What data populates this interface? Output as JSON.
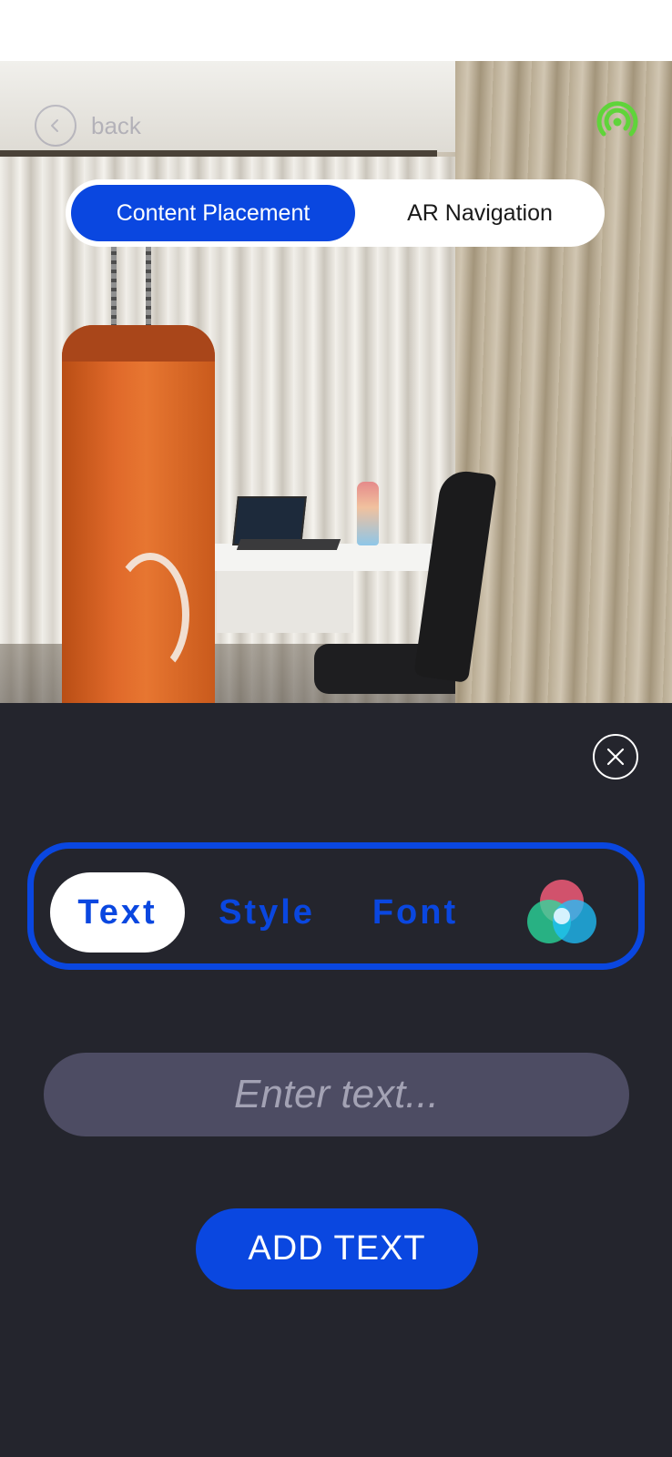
{
  "header": {
    "back_label": "back",
    "back_icon": "chevron-left-icon",
    "status_icon": "wifi-signal-icon",
    "status_color": "#5fd43a"
  },
  "mode_switch": {
    "options": [
      "Content Placement",
      "AR Navigation"
    ],
    "selected": "Content Placement"
  },
  "editor": {
    "close_icon": "close-icon",
    "tabs": [
      {
        "label": "Text",
        "active": true
      },
      {
        "label": "Style",
        "active": false
      },
      {
        "label": "Font",
        "active": false
      }
    ],
    "color_picker_icon": "color-wheel-icon",
    "input": {
      "value": "",
      "placeholder": "Enter text..."
    },
    "add_button_label": "ADD TEXT"
  },
  "colors": {
    "accent": "#0a47e0",
    "panel_bg": "#24252d",
    "input_bg": "#4d4c63"
  }
}
